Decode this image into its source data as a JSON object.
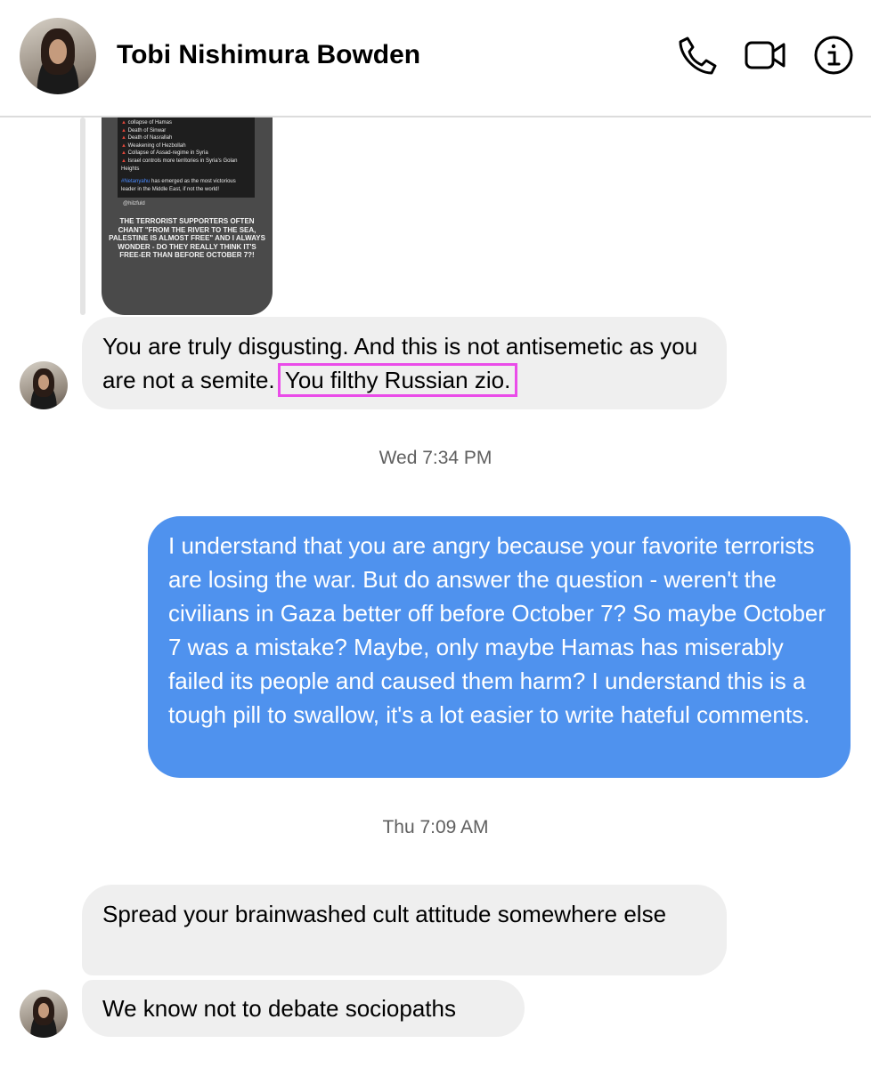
{
  "contact": {
    "name": "Tobi Nishimura Bowden"
  },
  "header_icons": [
    "phone-icon",
    "video-call-icon",
    "info-icon"
  ],
  "story": {
    "list_items": [
      "collapse of Hamas",
      "Death of Sinwar",
      "Death of Nasrallah",
      "Weakening of Hezbollah",
      "Collapse of Assad-regime in Syria",
      "Israel controls more territories in Syria's Golan Heights"
    ],
    "hashtag": "#Netanyahu",
    "hashtag_rest": "has emerged as the most victorious leader in the Middle East, if not the world!",
    "credit": "@hilzfuld",
    "caption": "THE TERRORIST SUPPORTERS OFTEN CHANT \"FROM THE RIVER TO THE SEA, PALESTINE IS ALMOST FREE\" AND I ALWAYS WONDER - DO THEY REALLY THINK IT'S FREE-ER THAN BEFORE OCTOBER 7?!"
  },
  "messages": {
    "m1_before": "You are truly disgusting. And this is not antisemetic as you are not a semite.",
    "m1_highlight": "You filthy Russian zio.",
    "ts1": "Wed 7:34 PM",
    "m2": "I understand that you are angry because your favorite terrorists are losing the war. But do answer the question - weren't the civilians in Gaza better off before October 7? So maybe October 7 was a mistake? Maybe, only maybe Hamas has miserably failed its people and caused them harm? I understand this is a tough pill to swallow, it's a lot easier to write hateful comments.",
    "ts2": "Thu 7:09 AM",
    "m3": "Spread your brainwashed cult attitude somewhere else",
    "m4": "We know not to debate sociopaths"
  },
  "colors": {
    "outgoing_bubble": "#4f92ee",
    "incoming_bubble": "#efefef",
    "highlight_box": "#ea4ce9"
  }
}
